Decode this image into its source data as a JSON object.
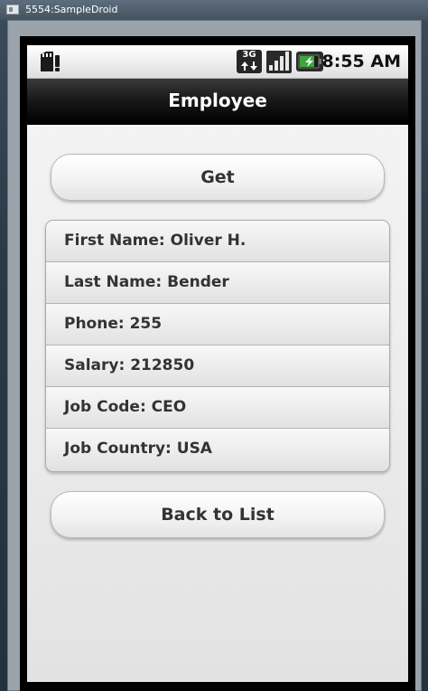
{
  "window": {
    "title": "5554:SampleDroid"
  },
  "statusbar": {
    "network_label": "3G",
    "time": "8:55 AM",
    "icons": {
      "sd": "sd-card-warning-icon",
      "network": "3g-data-icon",
      "signal": "signal-strength-icon",
      "battery": "battery-charging-icon"
    },
    "signal_bars": 4,
    "battery_level": 0.8
  },
  "actionbar": {
    "title": "Employee"
  },
  "buttons": {
    "get_label": "Get",
    "back_label": "Back to List"
  },
  "employee": {
    "fields": [
      "First Name: Oliver H.",
      "Last Name: Bender",
      "Phone: 255",
      "Salary: 212850",
      "Job Code: CEO",
      "Job Country: USA"
    ]
  },
  "colors": {
    "actionbar_bg": "#000000",
    "screen_bg": "#ececec",
    "text": "#333333",
    "battery_green": "#3aa83a"
  }
}
